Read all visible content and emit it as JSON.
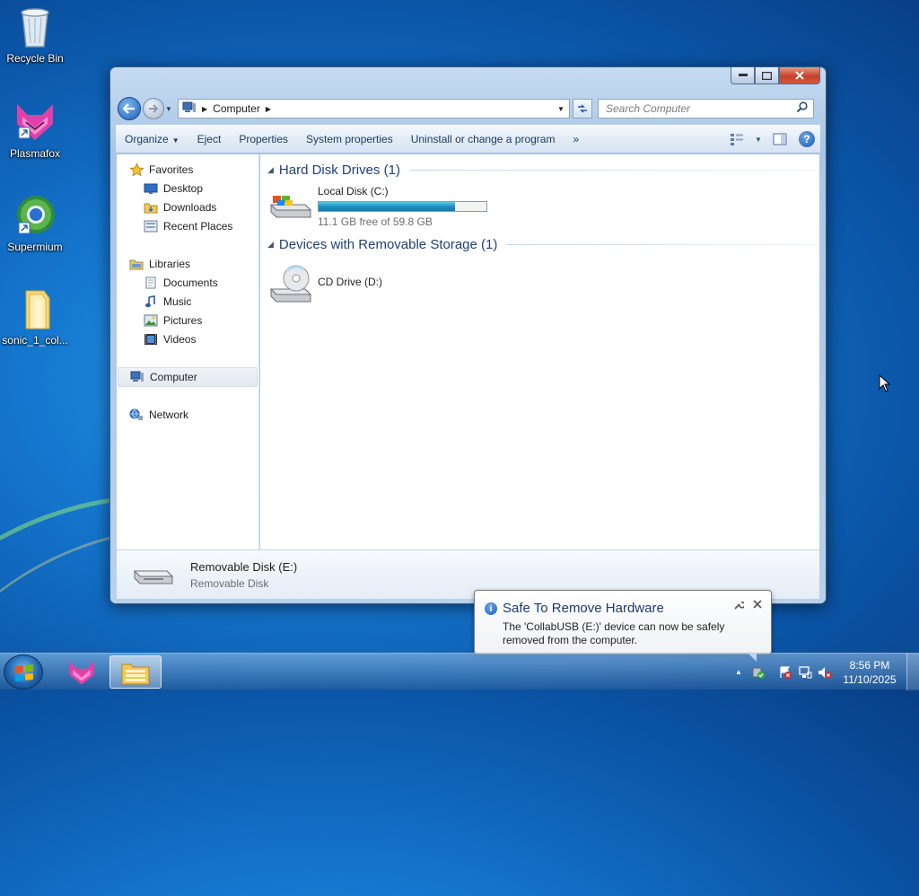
{
  "desktop": {
    "icons": [
      {
        "label": "Recycle Bin",
        "icon": "recycle-bin-icon"
      },
      {
        "label": "Plasmafox",
        "icon": "plasmafox-icon"
      },
      {
        "label": "Supermium",
        "icon": "supermium-icon"
      },
      {
        "label": "sonic_1_col...",
        "icon": "folder-icon"
      }
    ]
  },
  "window": {
    "address": {
      "crumbs": [
        "Computer"
      ]
    },
    "search": {
      "placeholder": "Search Computer"
    },
    "commands": [
      "Organize",
      "Eject",
      "Properties",
      "System properties",
      "Uninstall or change a program",
      "»"
    ],
    "nav_pane": {
      "favorites": {
        "label": "Favorites",
        "items": [
          "Desktop",
          "Downloads",
          "Recent Places"
        ]
      },
      "libraries": {
        "label": "Libraries",
        "items": [
          "Documents",
          "Music",
          "Pictures",
          "Videos"
        ]
      },
      "computer": "Computer",
      "network": "Network"
    },
    "groups": [
      {
        "title": "Hard Disk Drives (1)"
      },
      {
        "title": "Devices with Removable Storage (1)"
      }
    ],
    "drives": {
      "local": {
        "name": "Local Disk (C:)",
        "free_text": "11.1 GB free of 59.8 GB",
        "used_fraction": 0.814
      },
      "cd": {
        "name": "CD Drive (D:)"
      }
    },
    "details": {
      "title": "Removable Disk (E:)",
      "subtitle": "Removable Disk"
    }
  },
  "notification": {
    "title": "Safe To Remove Hardware",
    "message": "The 'CollabUSB (E:)' device can now be safely removed from the computer."
  },
  "taskbar": {
    "clock_time": "8:56 PM",
    "clock_date": "11/10/2025",
    "pinned": [
      "windows-start-orb",
      "plasmafox-icon",
      "windows-explorer-icon"
    ]
  },
  "colors": {
    "accent": "#1e3f7a",
    "progress": "#1f8ec3",
    "close": "#c7402a"
  }
}
